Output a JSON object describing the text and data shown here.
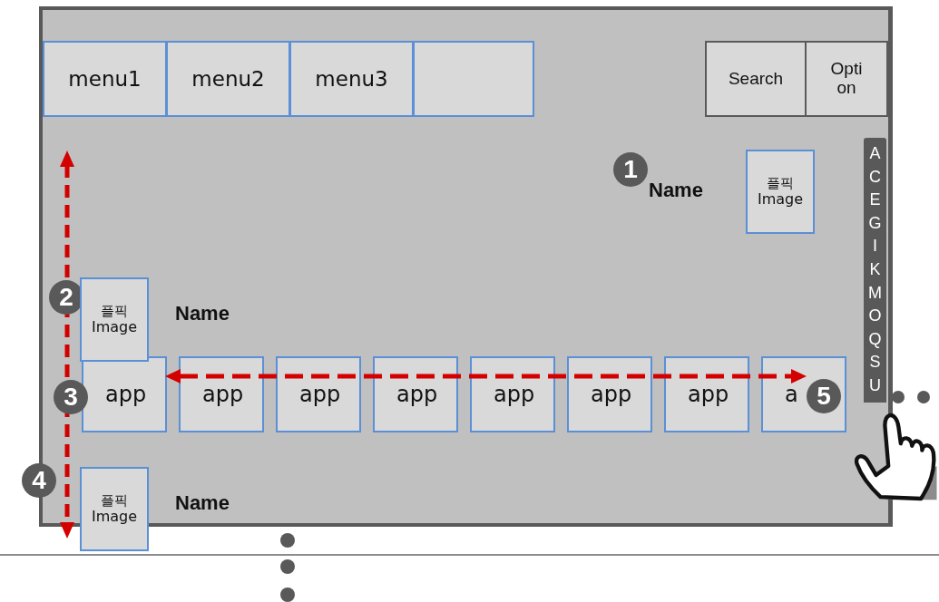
{
  "screen": {
    "menu_tabs": [
      {
        "label": "menu1"
      },
      {
        "label": "menu2"
      },
      {
        "label": "menu3"
      }
    ],
    "extra_empty_tab": true,
    "buttons": [
      "Search",
      "Option"
    ],
    "profile": {
      "name": "Name",
      "image_label": "플픽",
      "image_caption": "Image"
    },
    "list_items": [
      {
        "name": "Name",
        "image_label": "플픽",
        "image_caption": "Image"
      },
      {
        "name": "Name",
        "image_label": "플픽",
        "image_caption": "Image"
      }
    ],
    "apps": [
      "app",
      "app",
      "app",
      "app",
      "app",
      "app",
      "app",
      "a"
    ],
    "index_letters": [
      "A",
      "C",
      "E",
      "G",
      "I",
      "K",
      "M",
      "O",
      "Q",
      "S",
      "U"
    ]
  },
  "annotations": {
    "badges": [
      "1",
      "2",
      "3",
      "4",
      "5"
    ]
  }
}
